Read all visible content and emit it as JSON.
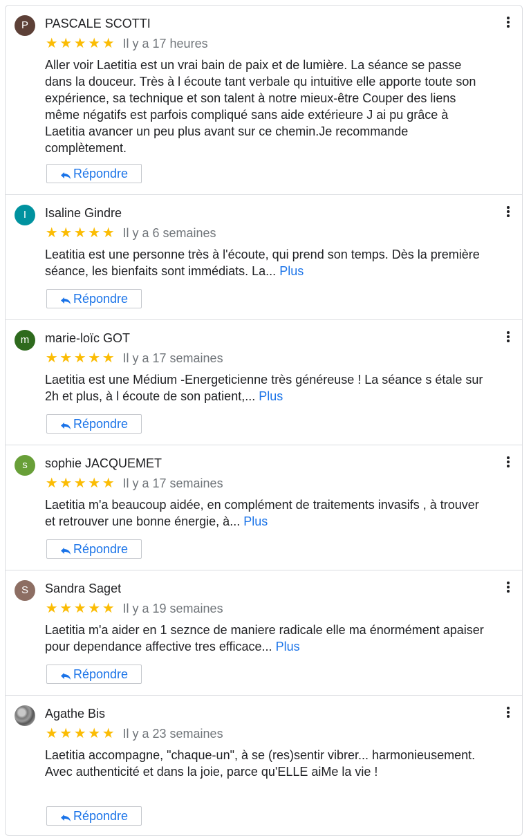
{
  "colors": {
    "star": "#fbbc04",
    "link": "#1a73e8",
    "muted": "#70757a"
  },
  "icons": {
    "star": "star-icon",
    "reply": "reply-icon",
    "menu": "more-vert-icon"
  },
  "reviews": [
    {
      "initial": "P",
      "avatar_color": "#5d4037",
      "name": "PASCALE SCOTTI",
      "rating": 5,
      "date": "Il y a 17 heures",
      "text": "Aller voir Laetitia est un vrai bain de paix et de lumière. La séance se passe dans la douceur. Très à l écoute tant verbale qu intuitive elle apporte toute son expérience, sa technique et son talent à notre mieux-être Couper des liens même négatifs est parfois compliqué sans aide extérieure J ai pu grâce à Laetitia avancer un peu plus avant sur ce chemin.Je recommande complètement.",
      "more": "",
      "reply": "Répondre"
    },
    {
      "initial": "I",
      "avatar_color": "#00929f",
      "name": "Isaline Gindre",
      "rating": 5,
      "date": "Il y a 6 semaines",
      "text": "Leatitia est une personne très à l'écoute, qui prend son temps. Dès la première séance, les bienfaits sont immédiats. La...",
      "more": "Plus",
      "reply": "Répondre"
    },
    {
      "initial": "m",
      "avatar_color": "#2e6a1d",
      "name": "marie-loïc GOT",
      "rating": 5,
      "date": "Il y a 17 semaines",
      "text": "Laetitia est une Médium -Energeticienne très généreuse ! La séance s étale sur 2h et plus, à l écoute de son patient,...",
      "more": "Plus",
      "reply": "Répondre"
    },
    {
      "initial": "s",
      "avatar_color": "#689f38",
      "name": "sophie JACQUEMET",
      "rating": 5,
      "date": "Il y a 17 semaines",
      "text": "Laetitia m'a beaucoup aidée, en complément de traitements invasifs , à trouver et retrouver une bonne énergie, à...",
      "more": "Plus",
      "reply": "Répondre"
    },
    {
      "initial": "S",
      "avatar_color": "#8d6e63",
      "name": "Sandra Saget",
      "rating": 5,
      "date": "Il y a 19 semaines",
      "text": "Laetitia m'a aider en 1 seznce de maniere radicale elle ma énormément apaiser pour dependance affective tres efficace...",
      "more": "Plus",
      "reply": "Répondre"
    },
    {
      "initial": "",
      "avatar_color": "",
      "name": "Agathe Bis",
      "rating": 5,
      "date": "Il y a 23 semaines",
      "text": "Laetitia accompagne, \"chaque-un\", à se (res)sentir vibrer... harmonieusement. Avec authenticité et dans la joie, parce qu'ELLE aiMe la vie !",
      "more": "",
      "reply": "Répondre"
    }
  ]
}
